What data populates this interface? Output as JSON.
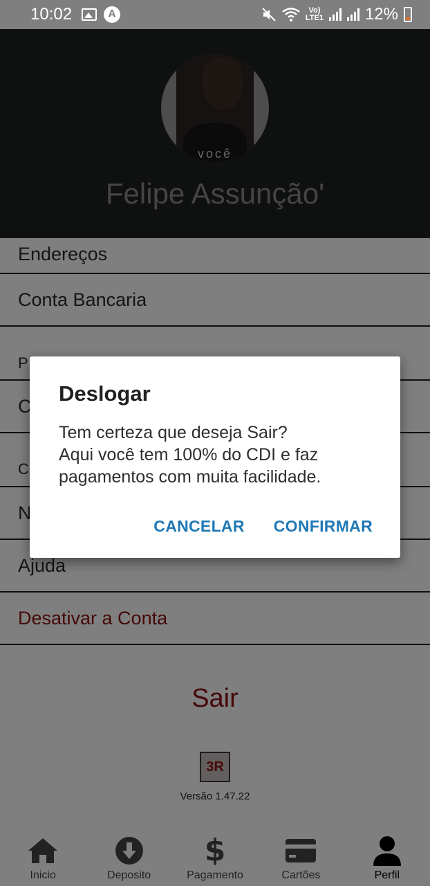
{
  "status_bar": {
    "time": "10:02",
    "battery": "12%",
    "network": "LTE1",
    "volte": "Vo)"
  },
  "profile": {
    "name": "Felipe Assunção'",
    "avatar_caption": "você"
  },
  "menu": {
    "items": [
      {
        "label": "Endereços"
      },
      {
        "label": "Conta Bancaria"
      },
      {
        "label": "P"
      },
      {
        "label": "C"
      },
      {
        "label": "C"
      },
      {
        "label": "N"
      },
      {
        "label": "Ajuda"
      },
      {
        "label": "Desativar a Conta"
      }
    ]
  },
  "sair_label": "Sair",
  "app_version": "Versão 1.47.22",
  "bottom_nav": {
    "items": [
      {
        "label": "Inicio",
        "icon": "home-icon"
      },
      {
        "label": "Deposito",
        "icon": "download-icon"
      },
      {
        "label": "Pagamento",
        "icon": "dollar-icon"
      },
      {
        "label": "Cartões",
        "icon": "card-icon"
      },
      {
        "label": "Perfil",
        "icon": "person-icon"
      }
    ]
  },
  "dialog": {
    "title": "Deslogar",
    "body_line1": "Tem certeza que deseja Sair?",
    "body_line2": "Aqui você tem 100% do CDI e faz",
    "body_line3": "pagamentos com muita facilidade.",
    "cancel_label": "CANCELAR",
    "confirm_label": "CONFIRMAR"
  },
  "colors": {
    "accent": "#1f78b4",
    "danger": "#8b1010",
    "header_bg": "#1f2121"
  }
}
